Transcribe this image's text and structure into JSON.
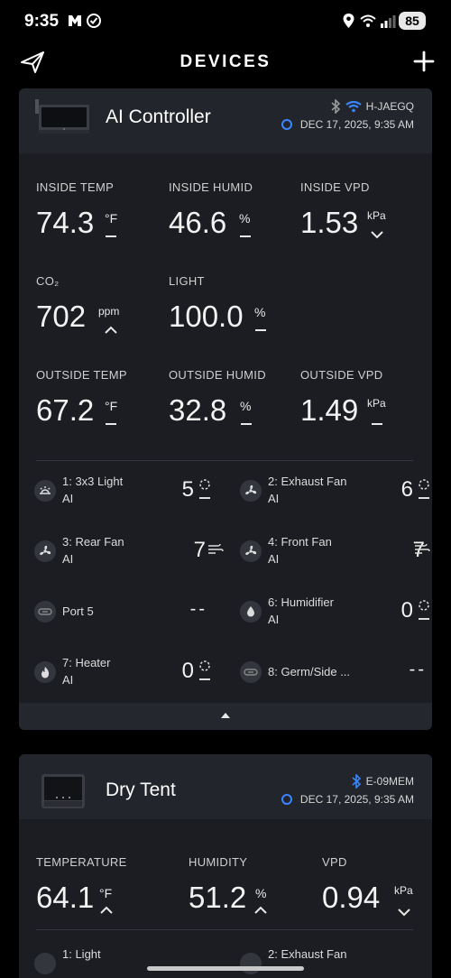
{
  "status_bar": {
    "time": "9:35",
    "battery": "85"
  },
  "header": {
    "title": "DEVICES"
  },
  "devices": [
    {
      "name": "AI Controller",
      "id": "H-JAEGQ",
      "timestamp": "DEC 17, 2025, 9:35 AM",
      "metrics": {
        "inside_temp": {
          "label": "INSIDE TEMP",
          "value": "74.3",
          "unit": "°F",
          "trend": "steady"
        },
        "inside_humid": {
          "label": "INSIDE HUMID",
          "value": "46.6",
          "unit": "%",
          "trend": "steady"
        },
        "inside_vpd": {
          "label": "INSIDE VPD",
          "value": "1.53",
          "unit": "kPa",
          "trend": "down"
        },
        "co2": {
          "label": "CO₂",
          "value": "702",
          "unit": "ppm",
          "trend": "up"
        },
        "light": {
          "label": "LIGHT",
          "value": "100.0",
          "unit": "%",
          "trend": "steady"
        },
        "outside_temp": {
          "label": "OUTSIDE TEMP",
          "value": "67.2",
          "unit": "°F",
          "trend": "steady"
        },
        "outside_humid": {
          "label": "OUTSIDE HUMID",
          "value": "32.8",
          "unit": "%",
          "trend": "steady"
        },
        "outside_vpd": {
          "label": "OUTSIDE VPD",
          "value": "1.49",
          "unit": "kPa",
          "trend": "steady"
        }
      },
      "ports": [
        {
          "name": "1: 3x3 Light",
          "mode": "AI",
          "value": "5",
          "icon": "light-icon"
        },
        {
          "name": "2: Exhaust Fan",
          "mode": "AI",
          "value": "6",
          "icon": "fan-icon"
        },
        {
          "name": "3: Rear Fan",
          "mode": "AI",
          "value": "7",
          "icon": "fan-icon"
        },
        {
          "name": "4: Front Fan",
          "mode": "AI",
          "value": "7",
          "icon": "fan-icon"
        },
        {
          "name": "Port 5",
          "mode": "",
          "value": "--",
          "icon": "plug-icon"
        },
        {
          "name": "6: Humidifier",
          "mode": "AI",
          "value": "0",
          "icon": "droplet-icon"
        },
        {
          "name": "7: Heater",
          "mode": "AI",
          "value": "0",
          "icon": "flame-icon"
        },
        {
          "name": "8: Germ/Side ...",
          "mode": "",
          "value": "--",
          "icon": "plug-icon"
        }
      ]
    },
    {
      "name": "Dry Tent",
      "id": "E-09MEM",
      "timestamp": "DEC 17, 2025, 9:35 AM",
      "metrics": {
        "temperature": {
          "label": "TEMPERATURE",
          "value": "64.1",
          "unit": "°F",
          "trend": "up"
        },
        "humidity": {
          "label": "HUMIDITY",
          "value": "51.2",
          "unit": "%",
          "trend": "up"
        },
        "vpd": {
          "label": "VPD",
          "value": "0.94",
          "unit": "kPa",
          "trend": "down"
        }
      },
      "ports": [
        {
          "name": "1: Light",
          "icon": "light-icon"
        },
        {
          "name": "2: Exhaust Fan",
          "icon": "fan-icon"
        }
      ]
    }
  ],
  "colors": {
    "accent": "#3a86ff",
    "card": "#1c1d22",
    "card_header": "#23252c"
  }
}
